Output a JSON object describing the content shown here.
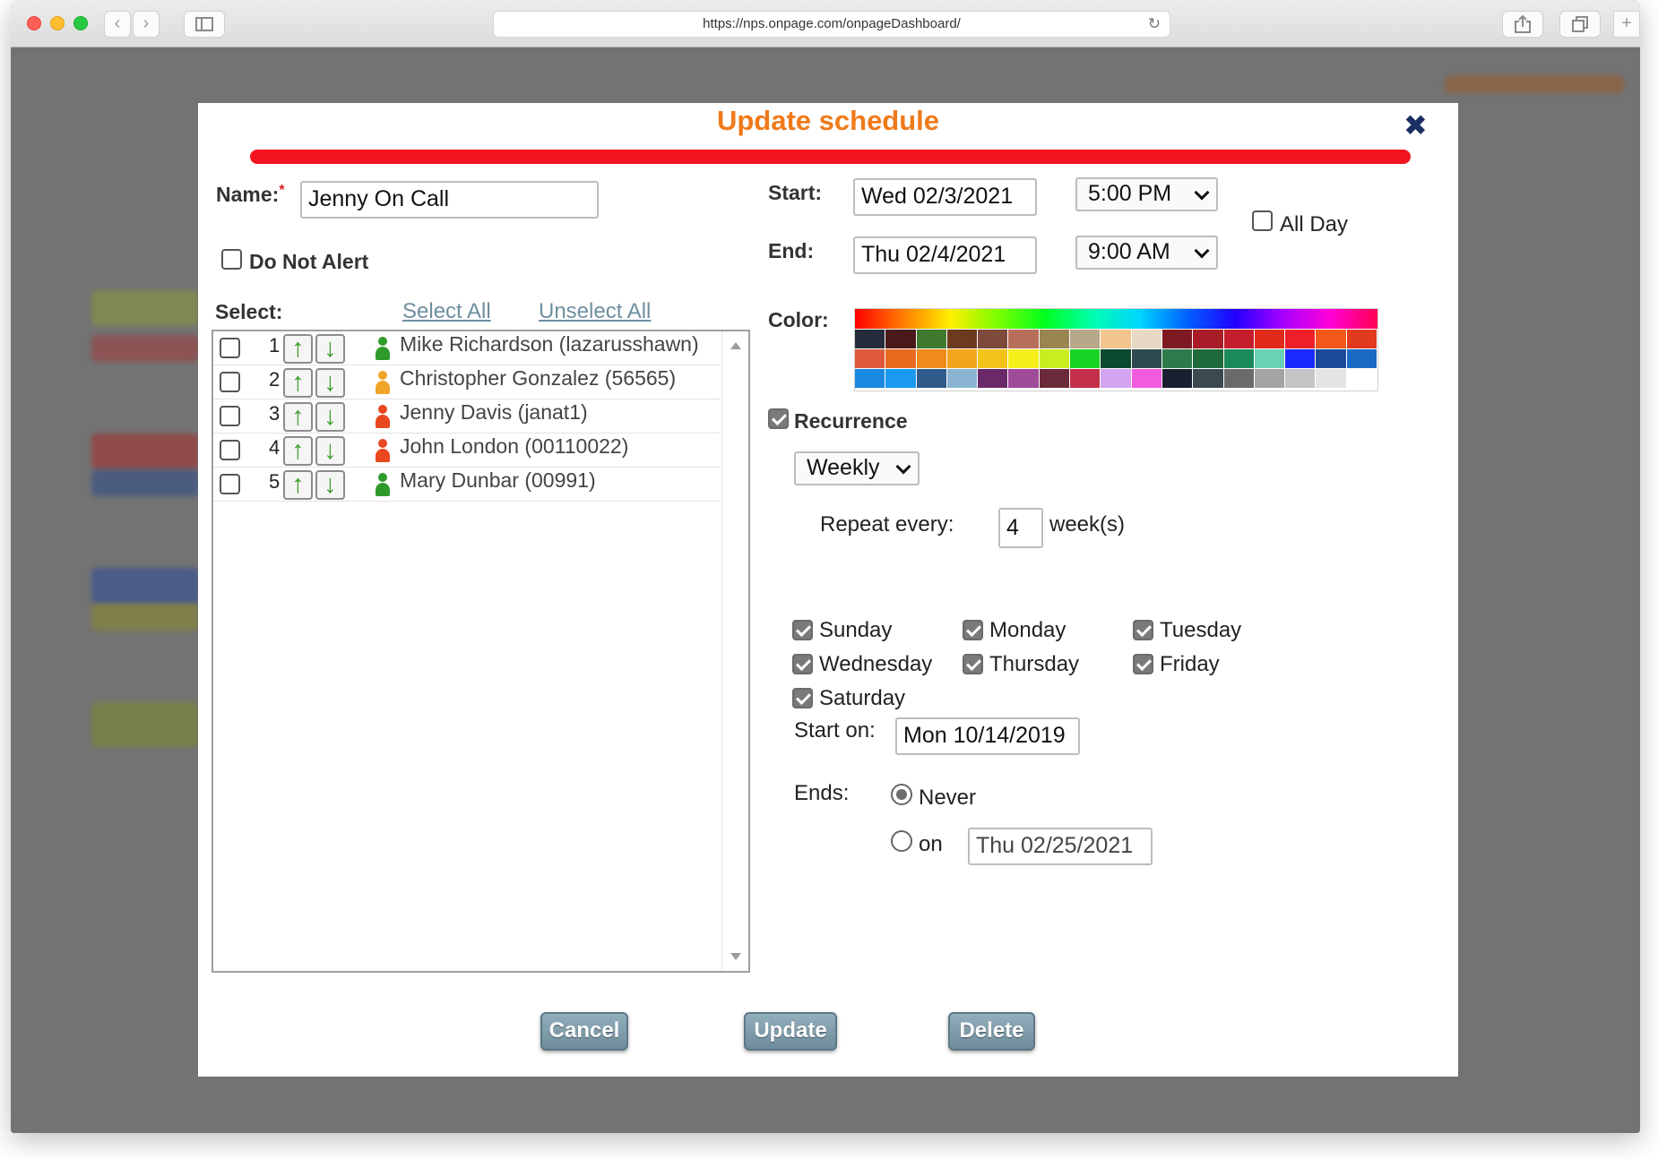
{
  "browser": {
    "url": "https://nps.onpage.com/onpageDashboard/"
  },
  "dialog": {
    "title": "Update schedule",
    "name_label": "Name:",
    "name_required_mark": "*",
    "name_value": "Jenny On Call",
    "do_not_alert_label": "Do Not Alert",
    "do_not_alert_checked": false,
    "select_label": "Select:",
    "select_all": "Select All",
    "unselect_all": "Unselect All",
    "members": [
      {
        "order": "1",
        "name": "Mike Richardson (lazarusshawn)",
        "status_color": "#2f9a2a",
        "selected": false
      },
      {
        "order": "2",
        "name": "Christopher Gonzalez (56565)",
        "status_color": "#f0a52a",
        "selected": false
      },
      {
        "order": "3",
        "name": "Jenny Davis (janat1)",
        "status_color": "#e8471f",
        "selected": false
      },
      {
        "order": "4",
        "name": "John London (00110022)",
        "status_color": "#e8471f",
        "selected": false
      },
      {
        "order": "5",
        "name": "Mary Dunbar (00991)",
        "status_color": "#2f9a2a",
        "selected": false
      }
    ],
    "start_label": "Start:",
    "start_date": "Wed 02/3/2021",
    "start_time": "5:00 PM",
    "end_label": "End:",
    "end_date": "Thu 02/4/2021",
    "end_time": "9:00 AM",
    "all_day_label": "All Day",
    "all_day_checked": false,
    "color_label": "Color:",
    "palette_colors": [
      "#252b3b",
      "#4a1a1a",
      "#3f7a2e",
      "#6b3a1f",
      "#7d4a3c",
      "#b86f5a",
      "#9a8550",
      "#b7a88a",
      "#f2c48e",
      "#e8d9c4",
      "#7e1a22",
      "#a81c28",
      "#c41d2c",
      "#e02b1a",
      "#ee1f2a",
      "#f2581a",
      "#e13a1f",
      "#df5a3a",
      "#e86a1f",
      "#f08a1a",
      "#f2a51a",
      "#f2c41a",
      "#f5ee1a",
      "#c8ee1f",
      "#1ad425",
      "#0b4a2f",
      "#2f4a4f",
      "#2f7a4a",
      "#1f6a3a",
      "#1a8a5a",
      "#6ad2b4",
      "#1a2aff",
      "#1a4a9a",
      "#1a6ac4",
      "#1a8ae0",
      "#1a9af2",
      "#2f5a8a",
      "#8ab4d2",
      "#6a2a6a",
      "#a04a9a",
      "#6a2a3a",
      "#c4304a",
      "#d4a4f2",
      "#f25ae0",
      "#1a1f2f",
      "#3a4a4f",
      "#6a6a6a",
      "#a4a4a4",
      "#c4c4c4",
      "#e4e4e4",
      "#ffffff"
    ],
    "recurrence_label": "Recurrence",
    "recurrence_checked": true,
    "frequency": "Weekly",
    "repeat_every_label": "Repeat every:",
    "repeat_every_value": "4",
    "repeat_unit": "week(s)",
    "days": [
      {
        "label": "Sunday",
        "checked": true
      },
      {
        "label": "Monday",
        "checked": true
      },
      {
        "label": "Tuesday",
        "checked": true
      },
      {
        "label": "Wednesday",
        "checked": true
      },
      {
        "label": "Thursday",
        "checked": true
      },
      {
        "label": "Friday",
        "checked": true
      },
      {
        "label": "Saturday",
        "checked": true
      }
    ],
    "start_on_label": "Start on:",
    "start_on_value": "Mon 10/14/2019",
    "ends_label": "Ends:",
    "ends_never_label": "Never",
    "ends_on_label": "on",
    "ends_selected": "never",
    "ends_on_date": "Thu 02/25/2021",
    "buttons": {
      "cancel": "Cancel",
      "update": "Update",
      "delete": "Delete"
    }
  }
}
